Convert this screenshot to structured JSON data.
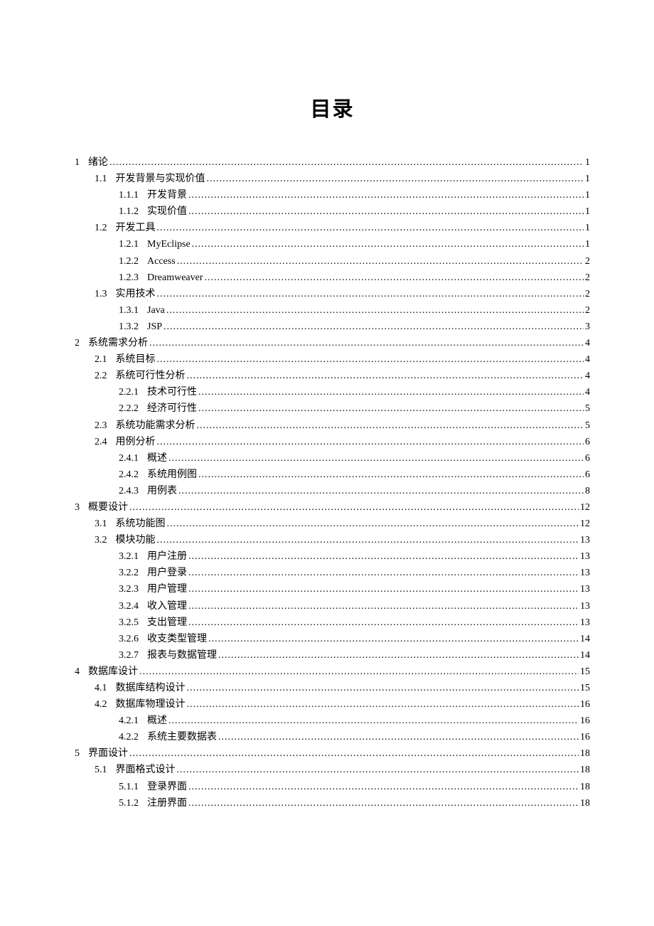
{
  "title": "目录",
  "entries": [
    {
      "level": 1,
      "num": "1",
      "label": "绪论",
      "page": "1"
    },
    {
      "level": 2,
      "num": "1.1",
      "label": "开发背景与实现价值",
      "page": "1"
    },
    {
      "level": 3,
      "num": "1.1.1",
      "label": "开发背景",
      "page": "1"
    },
    {
      "level": 3,
      "num": "1.1.2",
      "label": "实现价值",
      "page": "1"
    },
    {
      "level": 2,
      "num": "1.2",
      "label": "开发工具",
      "page": "1"
    },
    {
      "level": 3,
      "num": "1.2.1",
      "label": "MyEclipse",
      "page": "1"
    },
    {
      "level": 3,
      "num": "1.2.2",
      "label": "Access",
      "page": "2"
    },
    {
      "level": 3,
      "num": "1.2.3",
      "label": "Dreamweaver",
      "page": "2"
    },
    {
      "level": 2,
      "num": "1.3",
      "label": "实用技术",
      "page": "2"
    },
    {
      "level": 3,
      "num": "1.3.1",
      "label": "Java",
      "page": "2"
    },
    {
      "level": 3,
      "num": "1.3.2",
      "label": "JSP",
      "page": "3"
    },
    {
      "level": 1,
      "num": "2",
      "label": "系统需求分析",
      "page": "4"
    },
    {
      "level": 2,
      "num": "2.1",
      "label": "系统目标",
      "page": "4"
    },
    {
      "level": 2,
      "num": "2.2",
      "label": "系统可行性分析",
      "page": "4"
    },
    {
      "level": 3,
      "num": "2.2.1",
      "label": "技术可行性",
      "page": "4"
    },
    {
      "level": 3,
      "num": "2.2.2",
      "label": "经济可行性",
      "page": "5"
    },
    {
      "level": 2,
      "num": "2.3",
      "label": "系统功能需求分析",
      "page": "5"
    },
    {
      "level": 2,
      "num": "2.4",
      "label": "用例分析",
      "page": "6"
    },
    {
      "level": 3,
      "num": "2.4.1",
      "label": "概述",
      "page": "6"
    },
    {
      "level": 3,
      "num": "2.4.2",
      "label": "系统用例图",
      "page": "6"
    },
    {
      "level": 3,
      "num": "2.4.3",
      "label": "用例表",
      "page": "8"
    },
    {
      "level": 1,
      "num": "3",
      "label": "概要设计",
      "page": "12"
    },
    {
      "level": 2,
      "num": "3.1",
      "label": "系统功能图",
      "page": "12"
    },
    {
      "level": 2,
      "num": "3.2",
      "label": "模块功能",
      "page": "13"
    },
    {
      "level": 3,
      "num": "3.2.1",
      "label": "用户注册",
      "page": "13"
    },
    {
      "level": 3,
      "num": "3.2.2",
      "label": "用户登录",
      "page": "13"
    },
    {
      "level": 3,
      "num": "3.2.3",
      "label": "用户管理",
      "page": "13"
    },
    {
      "level": 3,
      "num": "3.2.4",
      "label": "收入管理",
      "page": "13"
    },
    {
      "level": 3,
      "num": "3.2.5",
      "label": "支出管理",
      "page": "13"
    },
    {
      "level": 3,
      "num": "3.2.6",
      "label": "收支类型管理",
      "page": "14"
    },
    {
      "level": 3,
      "num": "3.2.7",
      "label": "报表与数据管理",
      "page": "14"
    },
    {
      "level": 1,
      "num": "4",
      "label": "数据库设计",
      "page": "15"
    },
    {
      "level": 2,
      "num": "4.1",
      "label": "数据库结构设计",
      "page": "15"
    },
    {
      "level": 2,
      "num": "4.2",
      "label": "数据库物理设计",
      "page": "16"
    },
    {
      "level": 3,
      "num": "4.2.1",
      "label": "概述",
      "page": "16"
    },
    {
      "level": 3,
      "num": "4.2.2",
      "label": "系统主要数据表",
      "page": "16"
    },
    {
      "level": 1,
      "num": "5",
      "label": "界面设计",
      "page": "18"
    },
    {
      "level": 2,
      "num": "5.1",
      "label": "界面格式设计",
      "page": "18"
    },
    {
      "level": 3,
      "num": "5.1.1",
      "label": "登录界面",
      "page": "18"
    },
    {
      "level": 3,
      "num": "5.1.2",
      "label": "注册界面",
      "page": "18"
    }
  ]
}
